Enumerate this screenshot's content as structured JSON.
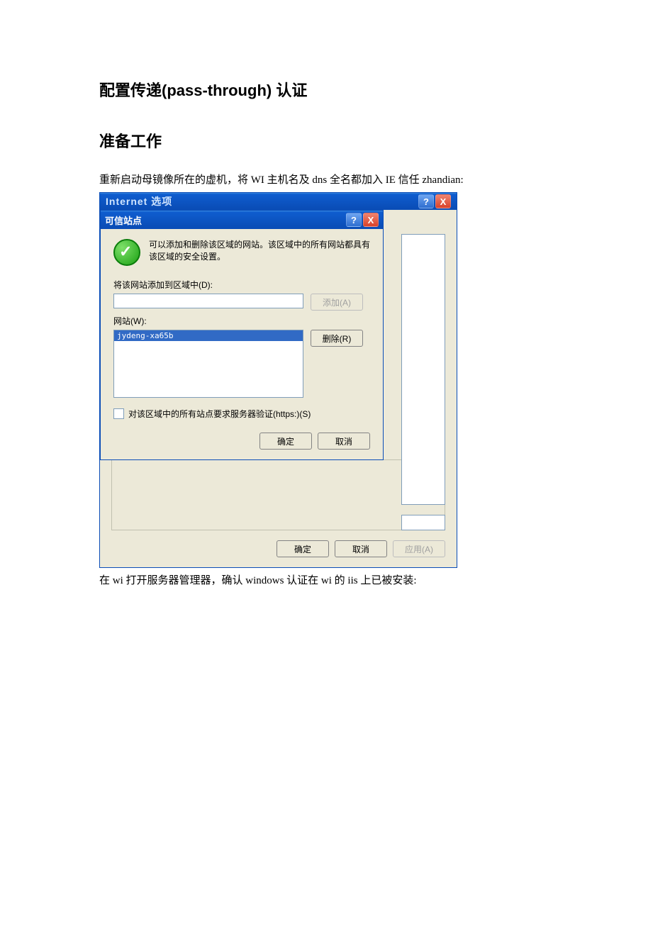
{
  "doc": {
    "heading1": "配置传递(pass-through) 认证",
    "heading2": "准备工作",
    "para1": "重新启动母镜像所在的虚机，将 WI 主机名及 dns 全名都加入 IE 信任 zhandian:",
    "para2": "在 wi 打开服务器管理器，确认 windows 认证在 wi 的 iis 上已被安装:"
  },
  "outer_window": {
    "title": "Internet 选项",
    "help_glyph": "?",
    "close_glyph": "X",
    "ok_label": "确定",
    "cancel_label": "取消",
    "apply_label": "应用(A)"
  },
  "trusted_dialog": {
    "title": "可信站点",
    "help_glyph": "?",
    "close_glyph": "X",
    "info_text": "可以添加和删除该区域的网站。该区域中的所有网站都具有该区域的安全设置。",
    "add_label_field": "将该网站添加到区域中(D):",
    "add_input_value": "",
    "add_button": "添加(A)",
    "sites_label": "网站(W):",
    "sites_items": [
      "jydeng-xa65b"
    ],
    "remove_button": "删除(R)",
    "https_checkbox_label": "对该区域中的所有站点要求服务器验证(https:)(S)",
    "https_checked": false,
    "ok_label": "确定",
    "cancel_label": "取消"
  }
}
